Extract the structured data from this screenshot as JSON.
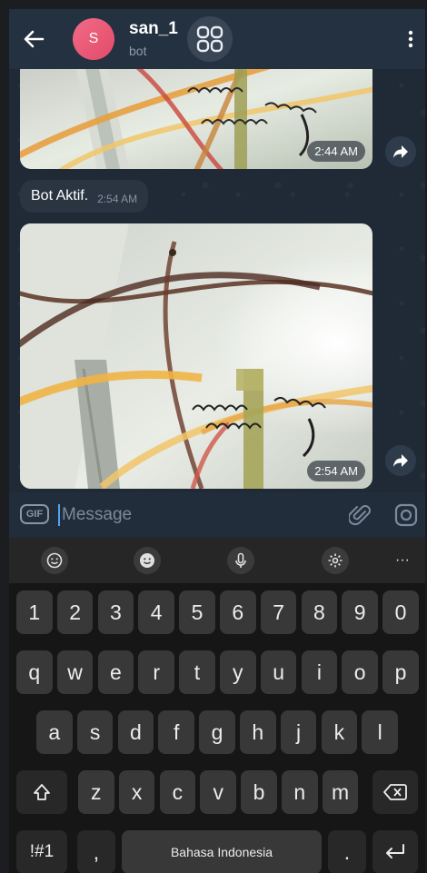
{
  "header": {
    "title": "san_1",
    "subtitle": "bot",
    "avatar_letter": "S",
    "avatar_color": "#e8587a"
  },
  "messages": {
    "photo1_time": "2:44 AM",
    "text_message": "Bot Aktif.",
    "text_message_time": "2:54 AM",
    "photo2_time": "2:54 AM"
  },
  "composer": {
    "gif_label": "GIF",
    "placeholder": "Message"
  },
  "keyboard": {
    "number_row": [
      "1",
      "2",
      "3",
      "4",
      "5",
      "6",
      "7",
      "8",
      "9",
      "0"
    ],
    "row1": [
      "q",
      "w",
      "e",
      "r",
      "t",
      "y",
      "u",
      "i",
      "o",
      "p"
    ],
    "row2": [
      "a",
      "s",
      "d",
      "f",
      "g",
      "h",
      "j",
      "k",
      "l"
    ],
    "row3": [
      "z",
      "x",
      "c",
      "v",
      "b",
      "n",
      "m"
    ],
    "symbols_label": "!#1",
    "comma_label": ",",
    "period_label": ".",
    "space_label": "Bahasa Indonesia",
    "more_label": "···"
  },
  "colors": {
    "accent": "#4ea4f2",
    "header_bg": "#243140",
    "chat_bg": "#1f2a36"
  }
}
